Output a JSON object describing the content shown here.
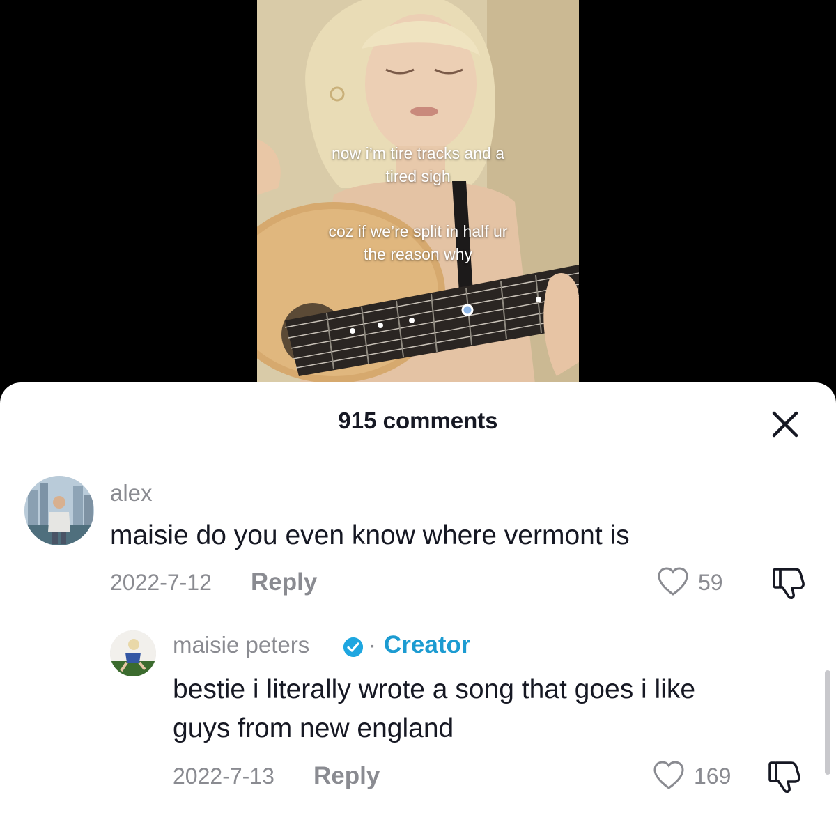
{
  "video": {
    "caption_1": [
      "now i’m tire tracks and a",
      "tired sigh"
    ],
    "caption_2": [
      "coz if we’re split in half ur",
      "the reason why"
    ]
  },
  "sheet": {
    "title": "915 comments",
    "close_icon": "close-icon"
  },
  "comments": [
    {
      "username": "alex",
      "text": "maisie do you even know where vermont is",
      "date": "2022-7-12",
      "reply_label": "Reply",
      "likes": "59"
    },
    {
      "username": "maisie peters",
      "verified": true,
      "separator": "·",
      "badge": "Creator",
      "text_lines": [
        "bestie i literally wrote a song that goes i like",
        "guys from new england"
      ],
      "date": "2022-7-13",
      "reply_label": "Reply",
      "likes": "169"
    }
  ],
  "colors": {
    "accent_creator": "#1c9bd1",
    "text_primary": "#161823",
    "text_secondary": "#8a8b91"
  }
}
